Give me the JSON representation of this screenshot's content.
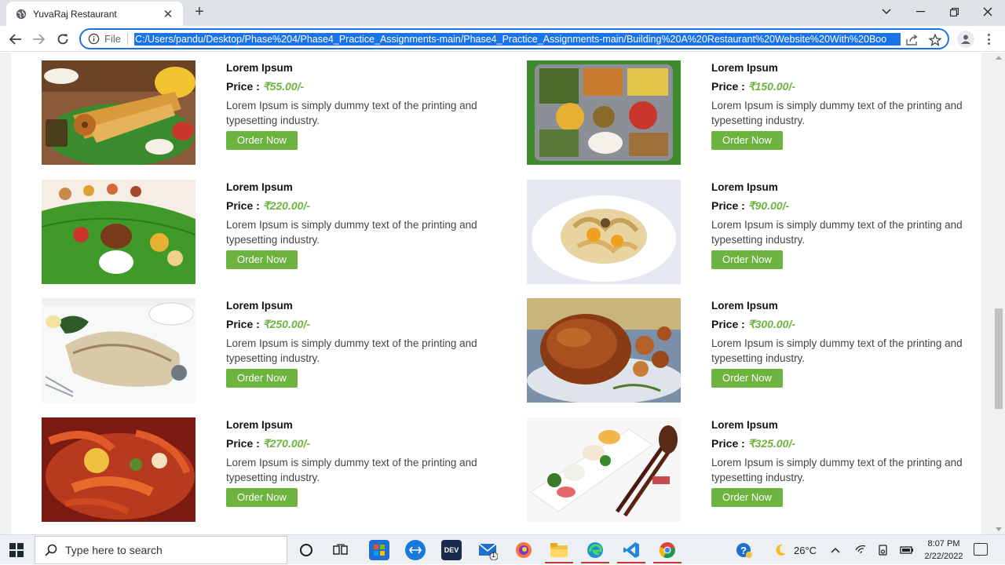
{
  "browser": {
    "tab_title": "YuvaRaj Restaurant",
    "file_label": "File",
    "url": "C:/Users/pandu/Desktop/Phase%204/Phase4_Practice_Assignments-main/Phase4_Practice_Assignments-main/Building%20A%20Restaurant%20Website%20With%20Boo"
  },
  "menu": {
    "items": [
      {
        "name": "Lorem Ipsum",
        "price_label": "Price : ",
        "price": "₹55.00/-",
        "description": "Lorem Ipsum is simply dummy text of the printing and typesetting industry.",
        "button": "Order Now",
        "image": "dosa-vada-plate"
      },
      {
        "name": "Lorem Ipsum",
        "price_label": "Price : ",
        "price": "₹150.00/-",
        "description": "Lorem Ipsum is simply dummy text of the printing and typesetting industry.",
        "button": "Order Now",
        "image": "thali-platter"
      },
      {
        "name": "Lorem Ipsum",
        "price_label": "Price : ",
        "price": "₹220.00/-",
        "description": "Lorem Ipsum is simply dummy text of the printing and typesetting industry.",
        "button": "Order Now",
        "image": "banana-leaf-meal"
      },
      {
        "name": "Lorem Ipsum",
        "price_label": "Price : ",
        "price": "₹90.00/-",
        "description": "Lorem Ipsum is simply dummy text of the printing and typesetting industry.",
        "button": "Order Now",
        "image": "pasta-plate"
      },
      {
        "name": "Lorem Ipsum",
        "price_label": "Price : ",
        "price": "₹250.00/-",
        "description": "Lorem Ipsum is simply dummy text of the printing and typesetting industry.",
        "button": "Order Now",
        "image": "grilled-fish"
      },
      {
        "name": "Lorem Ipsum",
        "price_label": "Price : ",
        "price": "₹300.00/-",
        "description": "Lorem Ipsum is simply dummy text of the printing and typesetting industry.",
        "button": "Order Now",
        "image": "roast-chicken"
      },
      {
        "name": "Lorem Ipsum",
        "price_label": "Price : ",
        "price": "₹270.00/-",
        "description": "Lorem Ipsum is simply dummy text of the printing and typesetting industry.",
        "button": "Order Now",
        "image": "seafood-platter"
      },
      {
        "name": "Lorem Ipsum",
        "price_label": "Price : ",
        "price": "₹325.00/-",
        "description": "Lorem Ipsum is simply dummy text of the printing and typesetting industry.",
        "button": "Order Now",
        "image": "sushi-chopsticks"
      }
    ]
  },
  "taskbar": {
    "search_placeholder": "Type here to search",
    "weather": "26°C",
    "time": "8:07 PM",
    "date": "2/22/2022",
    "mail_badge": "1"
  },
  "colors": {
    "accent_green": "#6db33f",
    "omnibox_blue": "#1a73e8"
  }
}
